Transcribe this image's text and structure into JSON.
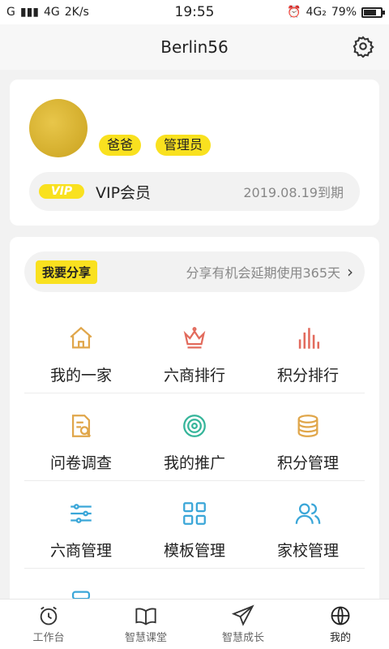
{
  "status": {
    "left": [
      "G",
      "4G",
      "2K/s"
    ],
    "time": "19:55",
    "network": "4G₂",
    "battery": "79%",
    "battery_level": 0.79
  },
  "header": {
    "title": "Berlin56"
  },
  "profile": {
    "badges": [
      "爸爸",
      "管理员"
    ],
    "vip_badge": "VIP",
    "vip_label": "VIP会员",
    "vip_expiry": "2019.08.19到期"
  },
  "share": {
    "button": "我要分享",
    "text": "分享有机会延期使用365天"
  },
  "menu": [
    {
      "label": "我的一家",
      "icon": "home-icon",
      "color": "#e0a64a"
    },
    {
      "label": "六商排行",
      "icon": "crown-icon",
      "color": "#e26b5d"
    },
    {
      "label": "积分排行",
      "icon": "bars-icon",
      "color": "#e26b5d"
    },
    {
      "label": "问卷调查",
      "icon": "survey-icon",
      "color": "#e0a64a"
    },
    {
      "label": "我的推广",
      "icon": "target-icon",
      "color": "#36b59a"
    },
    {
      "label": "积分管理",
      "icon": "coins-icon",
      "color": "#e0a64a"
    },
    {
      "label": "六商管理",
      "icon": "sliders-icon",
      "color": "#3aa6d8"
    },
    {
      "label": "模板管理",
      "icon": "grid-icon",
      "color": "#3aa6d8"
    },
    {
      "label": "家校管理",
      "icon": "users-icon",
      "color": "#3aa6d8"
    }
  ],
  "tabs": [
    {
      "label": "工作台",
      "icon": "alarm-clock-icon"
    },
    {
      "label": "智慧课堂",
      "icon": "book-icon"
    },
    {
      "label": "智慧成长",
      "icon": "paper-plane-icon"
    },
    {
      "label": "我的",
      "icon": "user-globe-icon"
    }
  ]
}
